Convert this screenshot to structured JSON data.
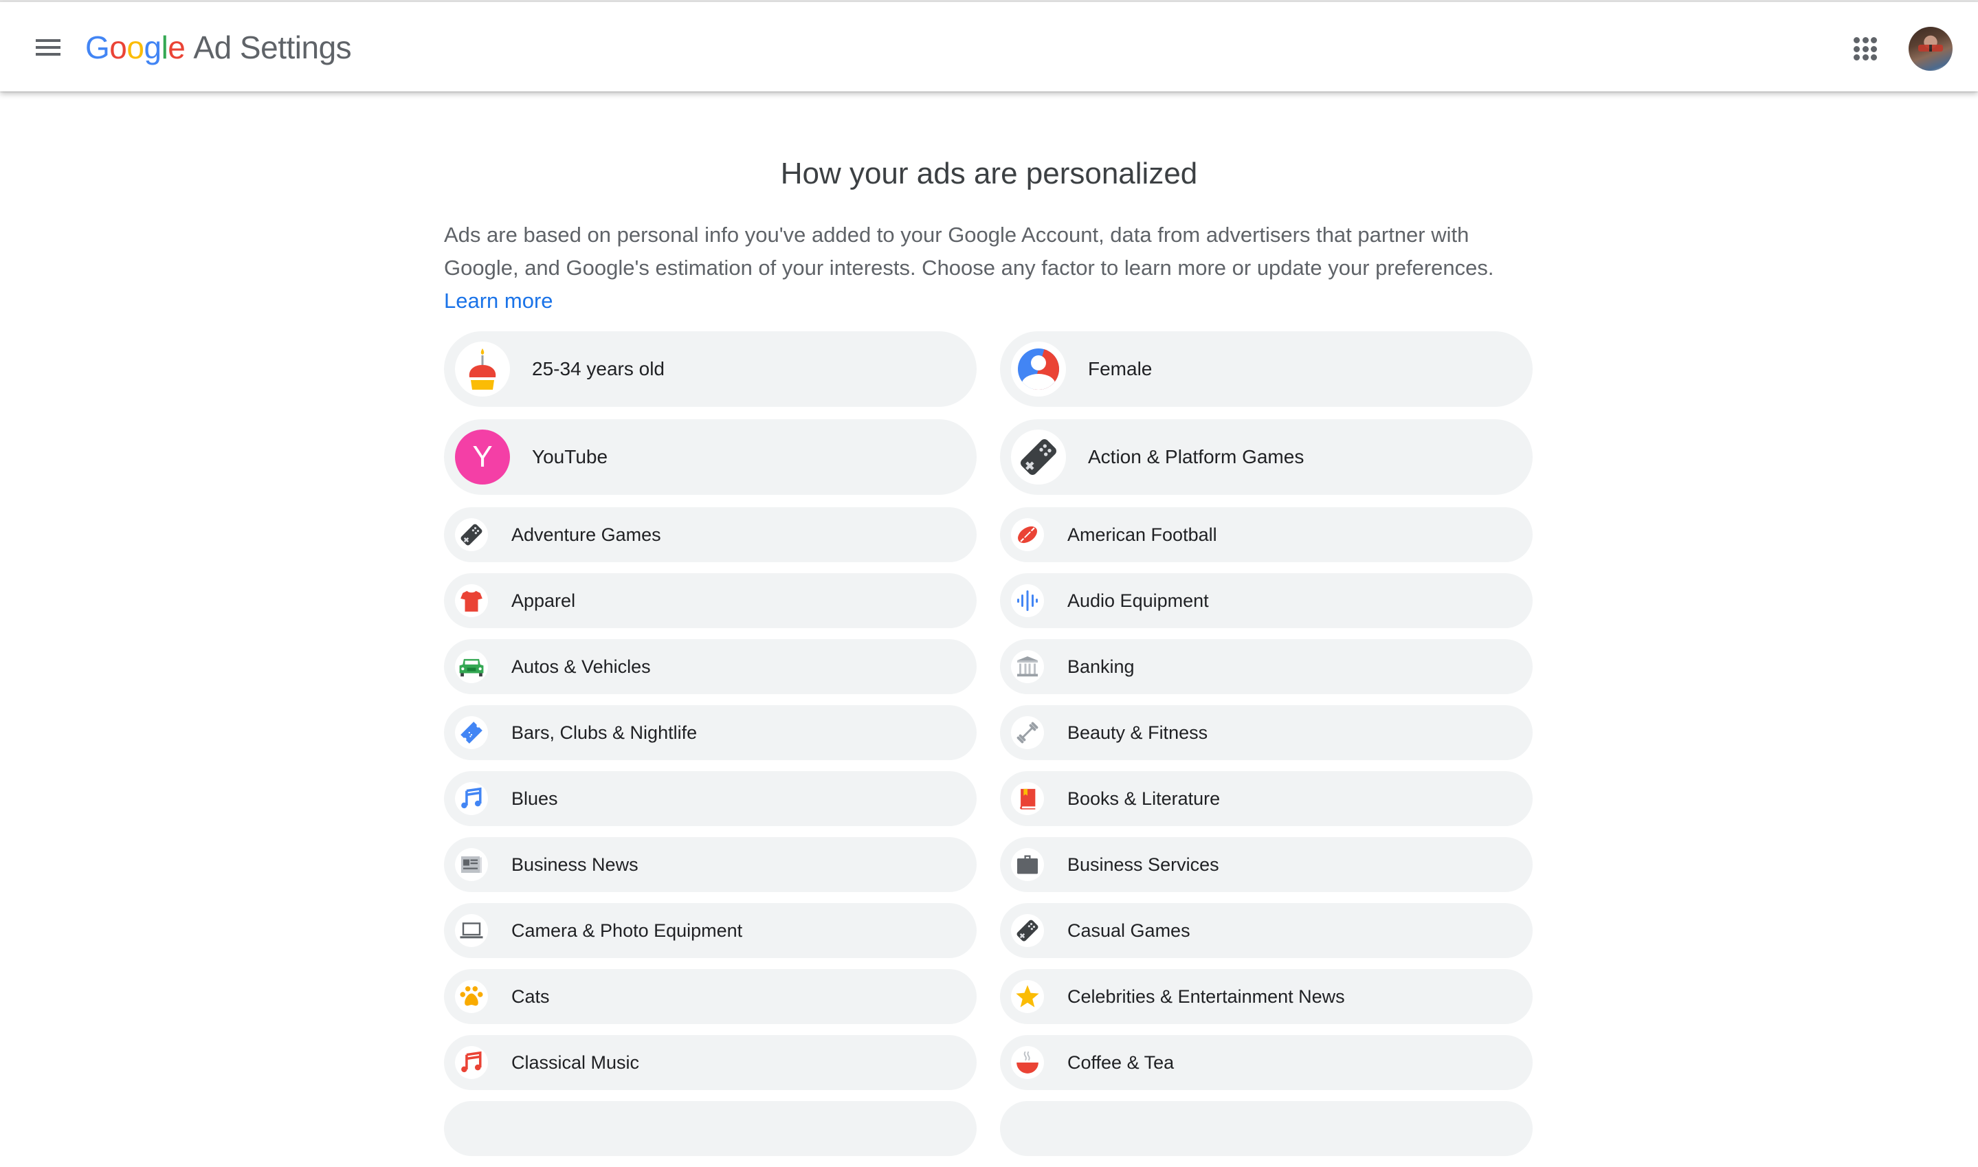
{
  "header": {
    "logo_letters": [
      "G",
      "o",
      "o",
      "g",
      "l",
      "e"
    ],
    "product_name": "Ad Settings",
    "menu_icon": "hamburger-menu-icon",
    "apps_icon": "apps-grid-icon",
    "avatar": "user-avatar"
  },
  "main": {
    "title": "How your ads are personalized",
    "description": "Ads are based on personal info you've added to your Google Account, data from advertisers that partner with Google, and Google's estimation of your interests. Choose any factor to learn more or update your preferences.",
    "learn_more": "Learn more"
  },
  "colors": {
    "google_blue": "#4285f4",
    "google_red": "#ea4335",
    "google_yellow": "#fbbc05",
    "google_green": "#34a853",
    "link": "#1a73e8",
    "pill_bg": "#f1f3f4",
    "youtube_badge": "#f43fa6"
  },
  "factors": {
    "profile": [
      {
        "label": "25-34 years old",
        "icon": "birthday-cupcake-icon"
      },
      {
        "label": "Female",
        "icon": "gender-person-icon"
      },
      {
        "label": "YouTube",
        "icon": "youtube-letter-icon",
        "letter": "Y"
      },
      {
        "label": "Action & Platform Games",
        "icon": "gamepad-icon"
      }
    ],
    "interests": [
      {
        "label": "Adventure Games",
        "icon": "gamepad-icon"
      },
      {
        "label": "American Football",
        "icon": "football-icon"
      },
      {
        "label": "Apparel",
        "icon": "tshirt-icon"
      },
      {
        "label": "Audio Equipment",
        "icon": "audio-wave-icon"
      },
      {
        "label": "Autos & Vehicles",
        "icon": "car-icon"
      },
      {
        "label": "Banking",
        "icon": "bank-icon"
      },
      {
        "label": "Bars, Clubs & Nightlife",
        "icon": "ticket-icon"
      },
      {
        "label": "Beauty & Fitness",
        "icon": "dumbbell-icon"
      },
      {
        "label": "Blues",
        "icon": "music-note-icon"
      },
      {
        "label": "Books & Literature",
        "icon": "book-icon"
      },
      {
        "label": "Business News",
        "icon": "newspaper-icon"
      },
      {
        "label": "Business Services",
        "icon": "briefcase-icon"
      },
      {
        "label": "Camera & Photo Equipment",
        "icon": "laptop-icon"
      },
      {
        "label": "Casual Games",
        "icon": "gamepad-icon"
      },
      {
        "label": "Cats",
        "icon": "paw-icon"
      },
      {
        "label": "Celebrities & Entertainment News",
        "icon": "star-icon"
      },
      {
        "label": "Classical Music",
        "icon": "music-note-icon"
      },
      {
        "label": "Coffee & Tea",
        "icon": "hot-cup-icon"
      },
      {
        "label": "",
        "icon": ""
      },
      {
        "label": "",
        "icon": ""
      }
    ]
  }
}
